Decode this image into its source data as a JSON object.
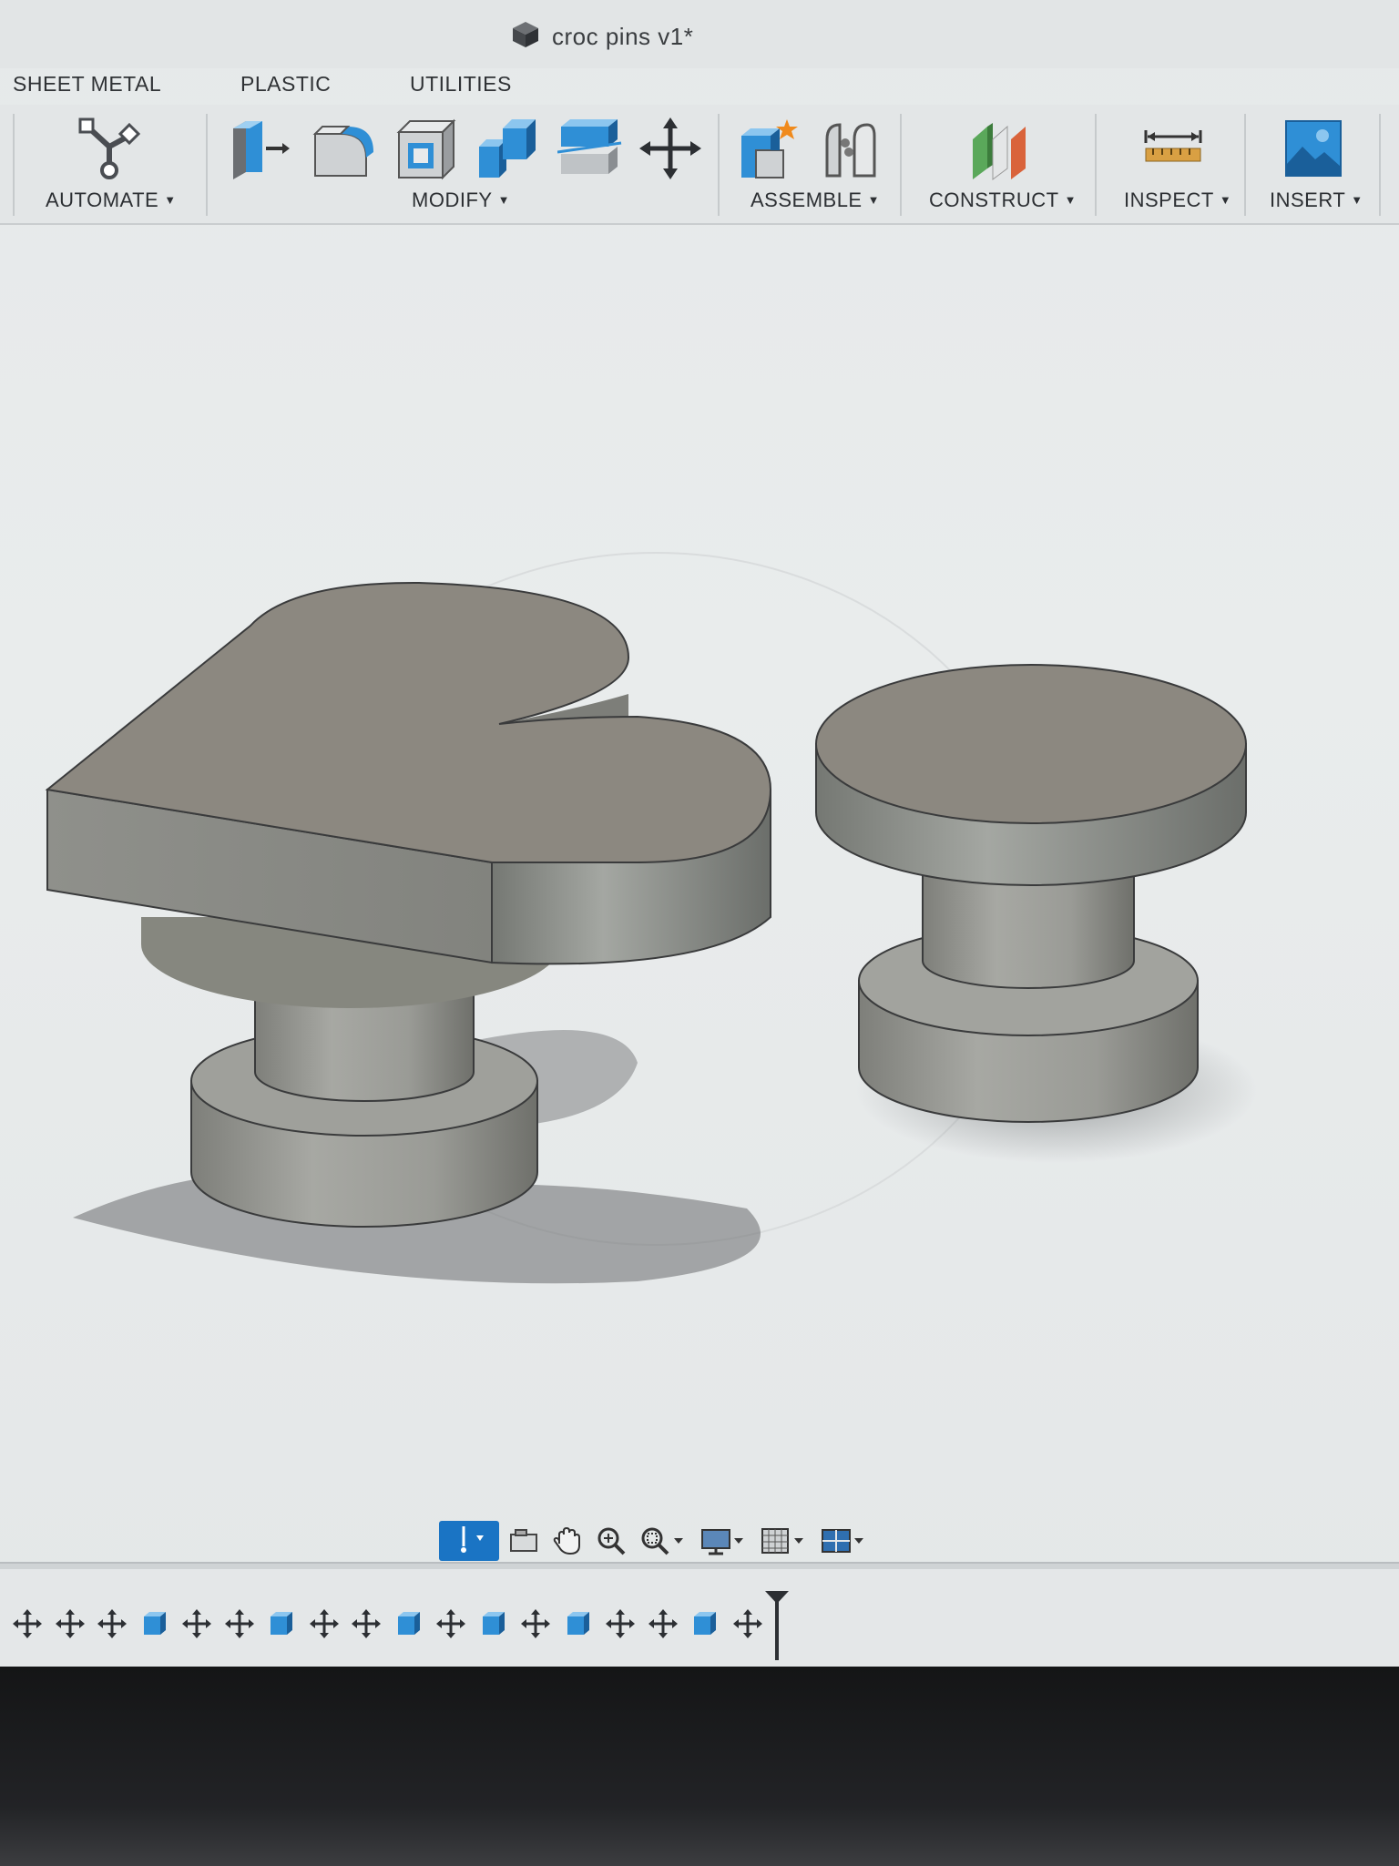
{
  "window": {
    "title": "croc pins v1*",
    "file_icon": "cube-icon"
  },
  "tabs": [
    "SHEET METAL",
    "PLASTIC",
    "UTILITIES"
  ],
  "ribbon": {
    "groups": [
      {
        "label": "AUTOMATE",
        "tools": [
          "automate-icon"
        ]
      },
      {
        "label": "MODIFY",
        "tools": [
          "press-pull-icon",
          "fillet-icon",
          "shell-icon",
          "combine-icon",
          "split-face-icon",
          "move-icon"
        ]
      },
      {
        "label": "ASSEMBLE",
        "tools": [
          "new-component-icon",
          "joint-icon"
        ]
      },
      {
        "label": "CONSTRUCT",
        "tools": [
          "offset-plane-icon"
        ]
      },
      {
        "label": "INSPECT",
        "tools": [
          "measure-icon"
        ]
      },
      {
        "label": "INSERT",
        "tools": [
          "insert-image-icon"
        ]
      }
    ]
  },
  "navigation_bar": [
    "orbit-icon",
    "look-at-icon",
    "pan-icon",
    "zoom-icon",
    "fit-icon",
    "display-settings-icon",
    "grid-icon",
    "viewports-icon"
  ],
  "timeline": {
    "features": [
      "sketch",
      "sketch",
      "sketch",
      "extrude",
      "sketch",
      "sketch",
      "extrude",
      "sketch",
      "sketch",
      "extrude",
      "sketch",
      "extrude",
      "sketch",
      "extrude",
      "sketch",
      "sketch",
      "extrude",
      "sketch"
    ]
  },
  "scene": {
    "objects": [
      "heart-pin-model",
      "round-pin-model"
    ]
  },
  "colors": {
    "accent": "#1a74c4",
    "icon_blue": "#2f8fd6",
    "model_gray": "#8e8d86",
    "model_top": "#8b877f"
  }
}
